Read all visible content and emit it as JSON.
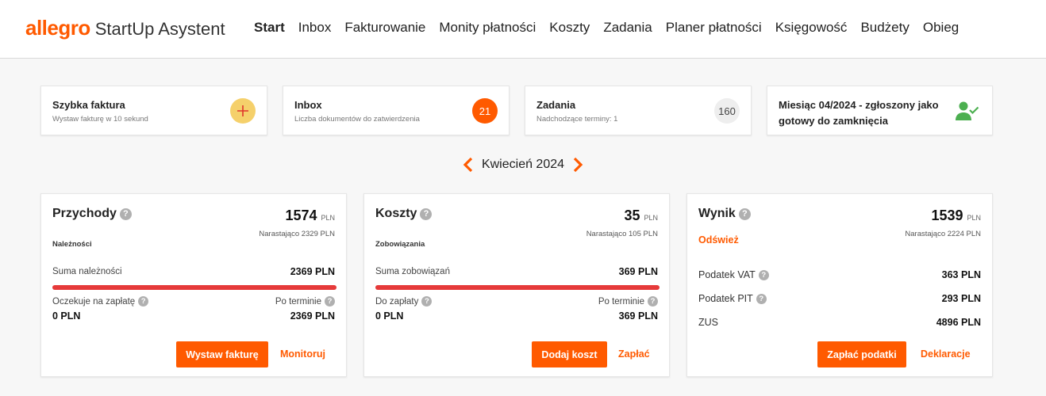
{
  "header": {
    "logo_brand": "allegro",
    "logo_product": "StartUp Asystent",
    "nav": [
      "Start",
      "Inbox",
      "Fakturowanie",
      "Monity płatności",
      "Koszty",
      "Zadania",
      "Planer płatności",
      "Księgowość",
      "Budżety",
      "Obieg"
    ],
    "active_nav": "Start"
  },
  "tiles": {
    "quick_invoice": {
      "title": "Szybka faktura",
      "subtitle": "Wystaw fakturę w 10 sekund",
      "icon": "plus-icon"
    },
    "inbox": {
      "title": "Inbox",
      "subtitle": "Liczba dokumentów do zatwierdzenia",
      "count": "21"
    },
    "tasks": {
      "title": "Zadania",
      "subtitle": "Nadchodzące terminy: 1",
      "count": "160"
    },
    "month": {
      "title": "Miesiąc 04/2024 - zgłoszony jako gotowy do zamknięcia",
      "icon": "user-check-icon"
    }
  },
  "period": {
    "label": "Kwiecień 2024"
  },
  "revenue": {
    "title": "Przychody",
    "amount": "1574",
    "currency": "PLN",
    "cumulative": "Narastająco 2329 PLN",
    "section": "Należności",
    "sum_label": "Suma należności",
    "sum_value": "2369 PLN",
    "progress": 1.0,
    "pending_label": "Oczekuje na zapłatę",
    "pending_value": "0 PLN",
    "overdue_label": "Po terminie",
    "overdue_value": "2369 PLN",
    "primary_button": "Wystaw fakturę",
    "link": "Monitoruj"
  },
  "costs": {
    "title": "Koszty",
    "amount": "35",
    "currency": "PLN",
    "cumulative": "Narastająco 105 PLN",
    "section": "Zobowiązania",
    "sum_label": "Suma zobowiązań",
    "sum_value": "369 PLN",
    "progress": 1.0,
    "pending_label": "Do zapłaty",
    "pending_value": "0 PLN",
    "overdue_label": "Po terminie",
    "overdue_value": "369 PLN",
    "primary_button": "Dodaj koszt",
    "link": "Zapłać"
  },
  "result": {
    "title": "Wynik",
    "amount": "1539",
    "currency": "PLN",
    "cumulative": "Narastająco 2224 PLN",
    "refresh": "Odśwież",
    "taxes": [
      {
        "label": "Podatek VAT",
        "value": "363 PLN",
        "help": true
      },
      {
        "label": "Podatek PIT",
        "value": "293 PLN",
        "help": true
      },
      {
        "label": "ZUS",
        "value": "4896 PLN",
        "help": false
      }
    ],
    "primary_button": "Zapłać podatki",
    "link": "Deklaracje"
  },
  "colors": {
    "accent": "#ff5a00",
    "bar": "#e63a3a",
    "success": "#4caf50"
  }
}
